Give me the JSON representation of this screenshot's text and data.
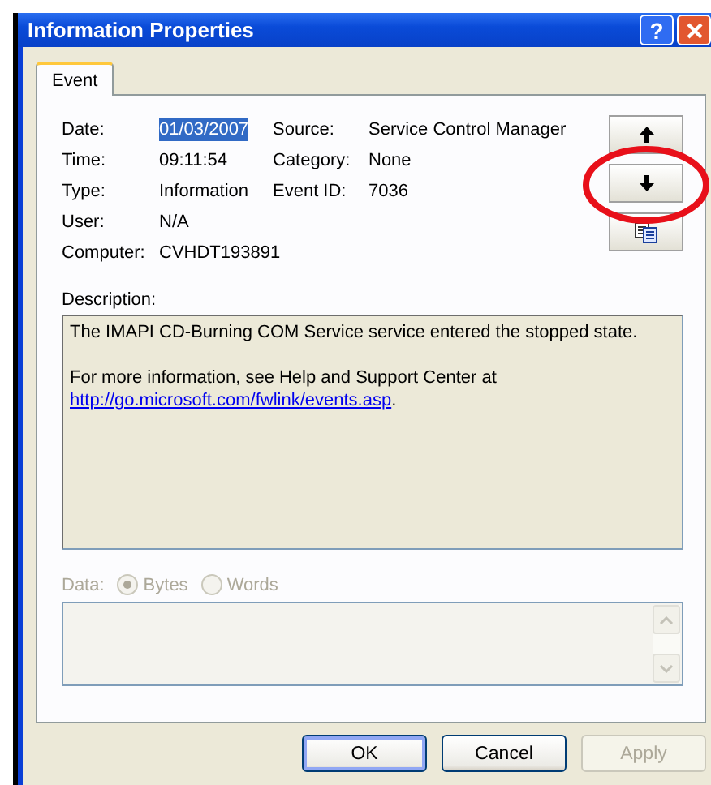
{
  "window": {
    "title": "Information Properties",
    "help_button": "?"
  },
  "tabs": [
    {
      "label": "Event",
      "selected": true
    }
  ],
  "field_rows": [
    [
      {
        "label": "Date:",
        "value": "01/03/2007",
        "selected": true
      },
      {
        "label": "Source:",
        "value": "Service Control Manager",
        "selected": false
      }
    ],
    [
      {
        "label": "Time:",
        "value": "09:11:54",
        "selected": false
      },
      {
        "label": "Category:",
        "value": "None",
        "selected": false
      }
    ],
    [
      {
        "label": "Type:",
        "value": "Information",
        "selected": false
      },
      {
        "label": "Event ID:",
        "value": "7036",
        "selected": false
      }
    ],
    [
      {
        "label": "User:",
        "value": "N/A",
        "selected": false
      }
    ],
    [
      {
        "label": "Computer:",
        "value": "CVHDT193891",
        "selected": false
      }
    ]
  ],
  "nav_buttons": [
    {
      "kind": "up",
      "highlighted": false
    },
    {
      "kind": "down",
      "highlighted": true
    },
    {
      "kind": "copy",
      "highlighted": false
    }
  ],
  "description": {
    "label": "Description:",
    "lines": [
      {
        "kind": "text",
        "text": "The IMAPI CD-Burning COM Service service entered the stopped state."
      },
      {
        "kind": "blank"
      },
      {
        "kind": "text",
        "text": "For more information, see Help and Support Center at"
      },
      {
        "kind": "link",
        "text": "http://go.microsoft.com/fwlink/events.asp",
        "suffix": "."
      }
    ]
  },
  "data": {
    "label": "Data:",
    "disabled": true,
    "options": [
      {
        "label": "Bytes",
        "selected": true
      },
      {
        "label": "Words",
        "selected": false
      }
    ]
  },
  "buttons": [
    {
      "label": "OK",
      "default": true,
      "disabled": false
    },
    {
      "label": "Cancel",
      "default": false,
      "disabled": false
    },
    {
      "label": "Apply",
      "default": false,
      "disabled": true
    }
  ]
}
